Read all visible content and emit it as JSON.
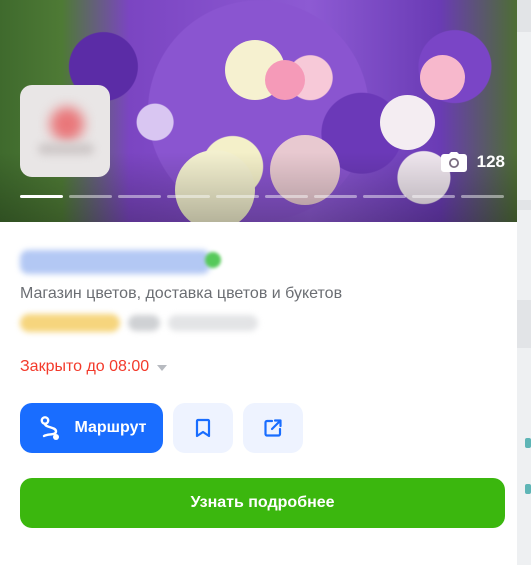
{
  "hero": {
    "photo_count": "128",
    "photo_icon": "camera-icon",
    "gallery_segments": 10,
    "active_segment": 1
  },
  "org": {
    "category": "Магазин цветов, доставка цветов и букетов"
  },
  "hours": {
    "status": "Закрыто до 08:00",
    "status_color": "#f33a2b"
  },
  "actions": {
    "route_label": "Маршрут",
    "route_icon": "route-icon",
    "bookmark_icon": "bookmark-icon",
    "share_icon": "share-icon",
    "more_label": "Узнать подробнее"
  },
  "colors": {
    "primary": "#196dff",
    "cta": "#3bb70e",
    "secondary_button": "#eef3ff"
  }
}
